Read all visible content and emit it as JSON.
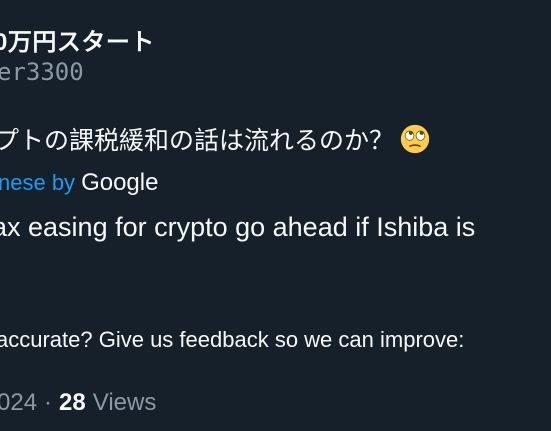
{
  "author": {
    "display_name": "0万円スタート",
    "handle": "er3300"
  },
  "tweet": {
    "original_text": "プトの課税緩和の話は流れるのか？",
    "emoji": "face-with-rolling-eyes",
    "translation_prefix": "nese by",
    "translation_provider": "Google",
    "translated_text": "ax easing for crypto go ahead if Ishiba is"
  },
  "feedback": {
    "prompt": "accurate? Give us feedback so we can improve:"
  },
  "meta": {
    "date_fragment": "024",
    "separator": "·",
    "views_count": "28",
    "views_label": "Views"
  },
  "colors": {
    "background": "#15202b",
    "text_primary": "#f7f9f9",
    "text_secondary": "#8b98a5",
    "link": "#1d9bf0"
  }
}
